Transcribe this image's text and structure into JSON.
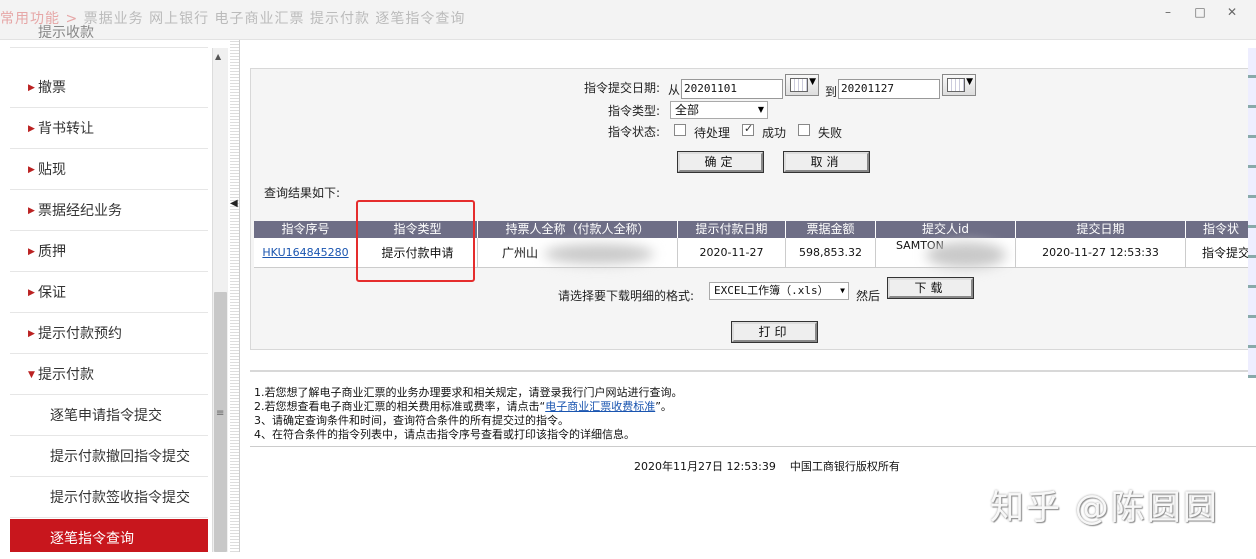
{
  "topbar": {
    "crumbs_red": "常用功能 >",
    "crumbs_rest": " 票据业务  网上银行  电子商业汇票  提示付款  逐笔指令查询",
    "minimize": "–",
    "maximize": "□",
    "close": "✕"
  },
  "sidebar": {
    "items": [
      {
        "label": "提示收款",
        "arrow": ""
      },
      {
        "label": "撤票",
        "arrow": "▶"
      },
      {
        "label": "背书转让",
        "arrow": "▶"
      },
      {
        "label": "贴现",
        "arrow": "▶"
      },
      {
        "label": "票据经纪业务",
        "arrow": "▶"
      },
      {
        "label": "质押",
        "arrow": "▶"
      },
      {
        "label": "保证",
        "arrow": "▶"
      },
      {
        "label": "提示付款预约",
        "arrow": "▶"
      },
      {
        "label": "提示付款",
        "arrow": "▼"
      },
      {
        "label": "逐笔申请指令提交",
        "arrow": ""
      },
      {
        "label": "提示付款撤回指令提交",
        "arrow": ""
      },
      {
        "label": "提示付款签收指令提交",
        "arrow": ""
      },
      {
        "label": "逐笔指令查询",
        "arrow": ""
      }
    ],
    "scroll_up": "▲",
    "scroll_grip": "≡",
    "collapse_arrow": "◀"
  },
  "query": {
    "date_label": "指令提交日期:",
    "from_label": "从",
    "from_value": "20201101",
    "to_label": "到",
    "to_value": "20201127",
    "type_label": "指令类型:",
    "type_value": "全部",
    "status_label": "指令状态:",
    "statuses": [
      {
        "label": "待处理",
        "checked": false
      },
      {
        "label": "成功",
        "checked": true
      },
      {
        "label": "失败",
        "checked": false
      }
    ],
    "confirm_label": "确定",
    "cancel_label": "取消"
  },
  "results": {
    "title": "查询结果如下:",
    "columns": [
      "指令序号",
      "指令类型",
      "持票人全称（付款人全称）",
      "提示付款日期",
      "票据金额",
      "提交人id",
      "提交日期",
      "指令状"
    ],
    "row": {
      "seq": "HKU164845280",
      "type": "提示付款申请",
      "holder": "广州山",
      "pay_date": "2020-11-27",
      "amount": "598,853.32",
      "submitter": "SAMTON",
      "submit_date": "2020-11-27 12:53:33",
      "status": "指令提交"
    }
  },
  "download": {
    "label": "请选择要下载明细的格式:",
    "format_value": "EXCEL工作簿（.xls）",
    "then_label": "然后",
    "download_label": "下载",
    "print_label": "打印"
  },
  "notes": {
    "line1": "1.若您想了解电子商业汇票的业务办理要求和相关规定，请登录我行门户网站进行查询。",
    "line2_pre": "2.若您想查看电子商业汇票的相关费用标准或费率，请点击“",
    "line2_link": "电子商业汇票收费标准",
    "line2_post": "”。",
    "line3": "3、请确定查询条件和时间，查询符合条件的所有提交过的指令。",
    "line4": "4、在符合条件的指令列表中，请点击指令序号查看或打印该指令的详细信息。"
  },
  "footer": {
    "datetime": "2020年11月27日 12:53:39",
    "copyright": "中国工商银行版权所有"
  },
  "watermark": "知乎 @陈圆圆"
}
